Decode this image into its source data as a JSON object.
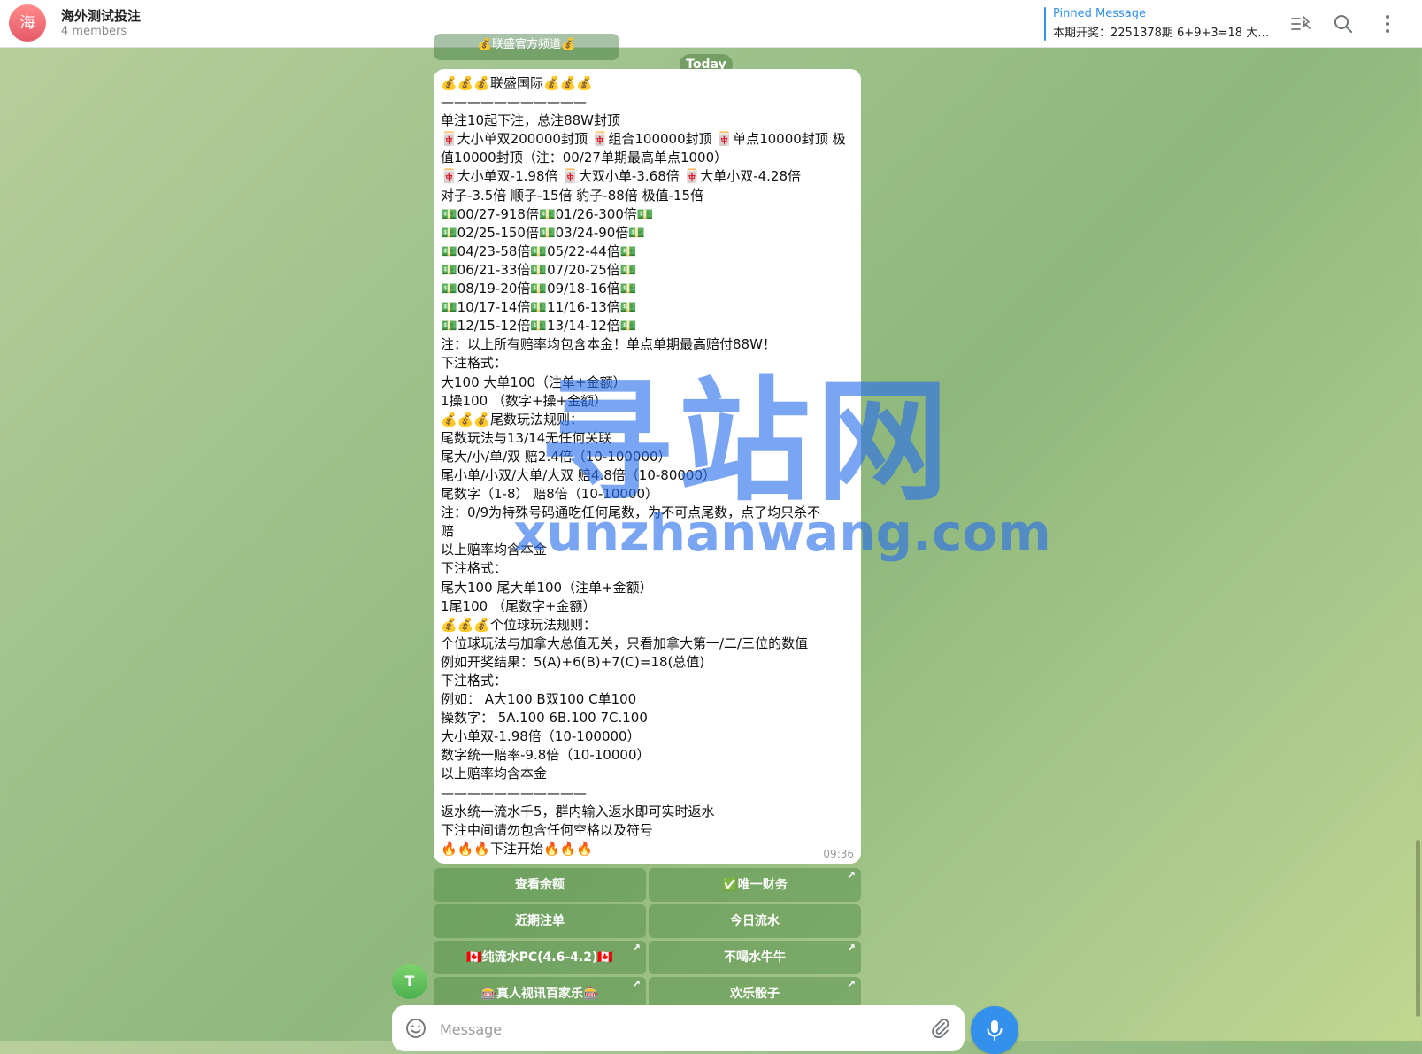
{
  "header": {
    "avatar_letter": "海",
    "title": "海外测试投注",
    "subtitle": "4 members",
    "pinned_label": "Pinned Message",
    "pinned_text": "本期开奖：2251378期 6+9+3=18 大…"
  },
  "icons": {
    "pinned_list": "pinned-list-icon",
    "search": "search-icon",
    "more": "more-vertical-icon",
    "emoji": "emoji-icon",
    "attach": "paperclip-icon",
    "mic": "microphone-icon"
  },
  "chat": {
    "prev_keyboard_label": "💰联盛官方频道💰",
    "date_badge": "Today",
    "message": {
      "lines": [
        "💰💰💰联盛国际💰💰💰",
        "———————————",
        "单注10起下注，总注88W封顶",
        "🀄大小单双200000封顶 🀄组合100000封顶 🀄单点10000封顶 极",
        "值10000封顶（注：00/27单期最高单点1000）",
        "🀄大小单双-1.98倍 🀄大双小单-3.68倍 🀄大单小双-4.28倍",
        "对子-3.5倍 顺子-15倍 豹子-88倍 极值-15倍",
        "💵00/27-918倍💵01/26-300倍💵",
        "💵02/25-150倍💵03/24-90倍💵",
        "💵04/23-58倍💵05/22-44倍💵",
        "💵06/21-33倍💵07/20-25倍💵",
        "💵08/19-20倍💵09/18-16倍💵",
        "💵10/17-14倍💵11/16-13倍💵",
        "💵12/15-12倍💵13/14-12倍💵",
        "注：以上所有赔率均包含本金！单点单期最高赔付88W！",
        "下注格式：",
        "大100 大单100（注单+金额）",
        "1操100 （数字+操+金额）",
        "💰💰💰尾数玩法规则：",
        "尾数玩法与13/14无任何关联",
        "尾大/小/单/双  赔2.4倍（10-100000）",
        "尾小单/小双/大单/大双  赔4.8倍（10-80000）",
        "尾数字（1-8）  赔8倍（10-10000）",
        "注：0/9为特殊号码通吃任何尾数，为不可点尾数，点了均只杀不",
        "赔",
        "以上赔率均含本金",
        "下注格式：",
        "尾大100 尾大单100（注单+金额）",
        "1尾100 （尾数字+金额）",
        "💰💰💰个位球玩法规则：",
        "个位球玩法与加拿大总值无关，只看加拿大第一/二/三位的数值",
        "例如开奖结果：5(A)+6(B)+7(C)=18(总值)",
        "下注格式：",
        "例如：    A大100  B双100  C单100",
        "操数字：  5A.100  6B.100   7C.100",
        "大小单双-1.98倍（10-100000）",
        "数字统一赔率-9.8倍（10-10000）",
        "以上赔率均含本金",
        "———————————",
        "返水统一流水千5，群内输入返水即可实时返水",
        "下注中间请勿包含任何空格以及符号",
        "🔥🔥🔥下注开始🔥🔥🔥"
      ],
      "time": "09:36"
    },
    "keyboard": [
      {
        "label": "查看余额",
        "arrow": ""
      },
      {
        "label": "✅唯一财务",
        "arrow": "↗"
      },
      {
        "label": "近期注单",
        "arrow": ""
      },
      {
        "label": "今日流水",
        "arrow": ""
      },
      {
        "label": "🇨🇦纯流水PC(4.6-4.2)🇨🇦",
        "arrow": "↗"
      },
      {
        "label": "不喝水牛牛",
        "arrow": "↗"
      },
      {
        "label": "🎰真人视讯百家乐🎰",
        "arrow": "↗"
      },
      {
        "label": "欢乐骰子",
        "arrow": "↗"
      }
    ],
    "sender_initial": "T"
  },
  "composer": {
    "placeholder": "Message",
    "value": ""
  },
  "watermark": {
    "big": "寻站网",
    "small": "xunzhanwang.com"
  },
  "colors": {
    "accent": "#3390ec",
    "keyboard_button": "#4e8a45"
  }
}
